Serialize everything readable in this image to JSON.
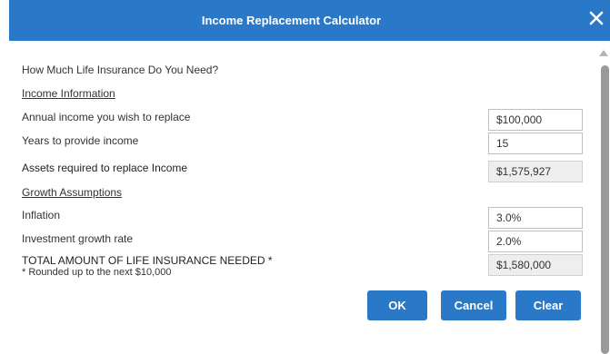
{
  "dialog": {
    "title": "Income Replacement Calculator",
    "close_icon": "close-icon"
  },
  "question": "How Much Life Insurance Do You Need?",
  "income_section": {
    "heading": "Income Information",
    "annual_income_label": "Annual income you wish to replace",
    "annual_income_value": "$100,000",
    "years_label": "Years to provide income",
    "years_value": "15",
    "assets_label": "Assets required to replace Income",
    "assets_value": "$1,575,927"
  },
  "growth_section": {
    "heading": "Growth Assumptions",
    "inflation_label": "Inflation",
    "inflation_value": "3.0%",
    "investment_label": "Investment growth rate",
    "investment_value": "2.0%"
  },
  "total": {
    "label": "TOTAL AMOUNT OF LIFE INSURANCE NEEDED *",
    "note": "* Rounded up to the next $10,000",
    "value": "$1,580,000"
  },
  "buttons": {
    "ok": "OK",
    "cancel": "Cancel",
    "clear": "Clear"
  },
  "colors": {
    "accent": "#2a79c9",
    "readonly_bg": "#eeeeee"
  }
}
